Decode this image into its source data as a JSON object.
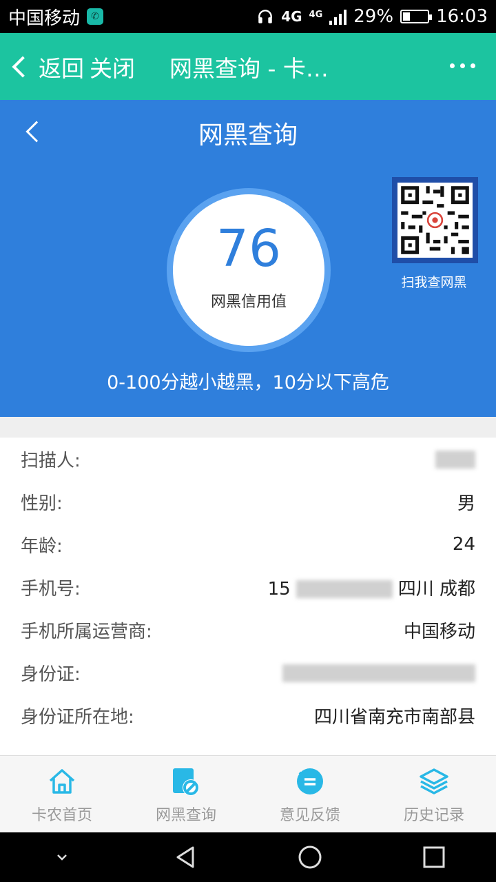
{
  "status_bar": {
    "carrier": "中国移动",
    "network_1": "4G",
    "network_2": "4G",
    "battery_percent": "29%",
    "battery_level": 0.29,
    "time": "16:03",
    "icons": [
      "phone-app-icon",
      "headset-icon",
      "signal-icon",
      "battery-icon"
    ]
  },
  "app_bar": {
    "back_label": "返回",
    "close_label": "关闭",
    "title": "网黑查询 - 卡…",
    "more_icon": "more-dots-icon"
  },
  "hero": {
    "title": "网黑查询",
    "score": "76",
    "score_label": "网黑信用值",
    "qr_label": "扫我查网黑",
    "tagline": "0-100分越小越黑，10分以下高危",
    "colors": {
      "background": "#2f7fdc",
      "app_bar": "#1cc4a0"
    }
  },
  "info": {
    "rows": [
      {
        "label": "扫描人:",
        "value": ""
      },
      {
        "label": "性别:",
        "value": "男"
      },
      {
        "label": "年龄:",
        "value": "24"
      },
      {
        "label": "手机号:",
        "prefix": "15",
        "value": "四川 成都"
      },
      {
        "label": "手机所属运营商:",
        "value": "中国移动"
      },
      {
        "label": "身份证:",
        "value": ""
      },
      {
        "label": "身份证所在地:",
        "value": "四川省南充市南部县"
      }
    ]
  },
  "tabs": [
    {
      "label": "卡农首页",
      "icon": "home-icon"
    },
    {
      "label": "网黑查询",
      "icon": "blacklist-query-icon"
    },
    {
      "label": "意见反馈",
      "icon": "feedback-icon"
    },
    {
      "label": "历史记录",
      "icon": "history-layers-icon"
    }
  ],
  "nav_bar": {
    "icons": [
      "collapse-icon",
      "back-triangle-icon",
      "home-circle-icon",
      "recents-square-icon"
    ]
  }
}
